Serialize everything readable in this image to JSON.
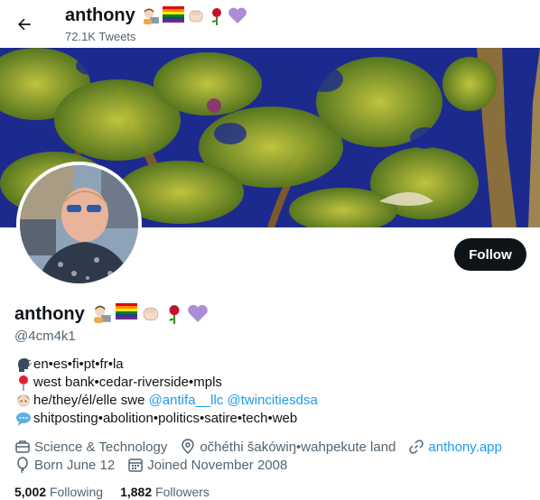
{
  "header": {
    "name": "anthony",
    "tweet_count": "72.1K Tweets",
    "back_icon": "arrow-left-icon"
  },
  "name_emojis": [
    "technologist",
    "rainbow-flag",
    "raised-fist",
    "rose",
    "purple-heart"
  ],
  "profile": {
    "name": "anthony",
    "handle": "@4cm4k1",
    "follow_label": "Follow"
  },
  "bio": {
    "line1": {
      "icon": "speaking-head-icon",
      "text": "en•es•fi•pt•fr•la"
    },
    "line2": {
      "icon": "pin-icon",
      "text": "west bank•cedar-riverside•mpls"
    },
    "line3": {
      "icon": "person-icon",
      "text": "he/they/él/elle swe ",
      "link1": "@antifa__llc",
      "sep": " ",
      "link2": "@twincitiesdsa"
    },
    "line4": {
      "icon": "speech-bubble-icon",
      "text": "shitposting•abolition•politics•satire•tech•web"
    }
  },
  "meta": {
    "category": "Science & Technology",
    "location": "očhéthi šakówiŋ•wahpekute land",
    "website": "anthony.app",
    "birthday": "Born June 12",
    "joined": "Joined November 2008"
  },
  "counts": {
    "following_num": "5,002",
    "following_label": "Following",
    "followers_num": "1,882",
    "followers_label": "Followers"
  },
  "colors": {
    "link": "#1d9bf0",
    "secondary": "#536471",
    "primary": "#0f1419",
    "banner_sky": "#1a2a9a"
  }
}
